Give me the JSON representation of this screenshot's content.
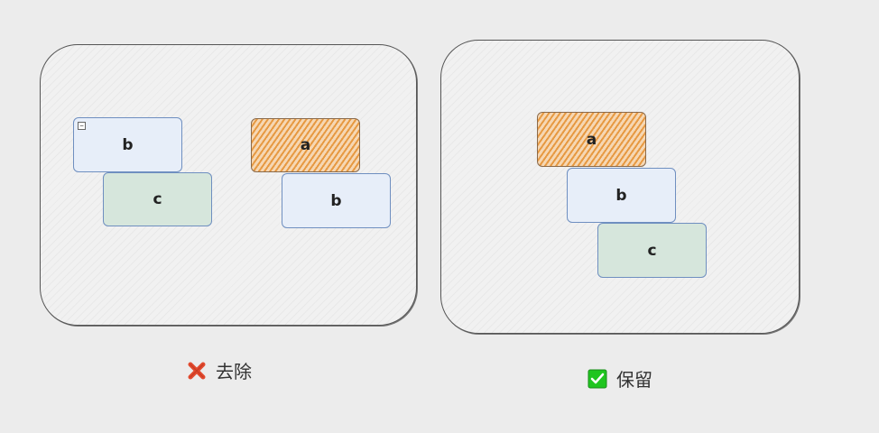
{
  "left_panel": {
    "nodes": [
      "b",
      "c",
      "a",
      "b"
    ]
  },
  "right_panel": {
    "nodes": [
      "a",
      "b",
      "c"
    ]
  },
  "captions": {
    "remove": "去除",
    "keep": "保留"
  },
  "colors": {
    "blue_fill": "#e7eef9",
    "green_fill": "#d6e6dc",
    "orange_fill": "#f6d7b3",
    "remove_icon": "#e24a2f",
    "keep_icon": "#1fc51f"
  }
}
